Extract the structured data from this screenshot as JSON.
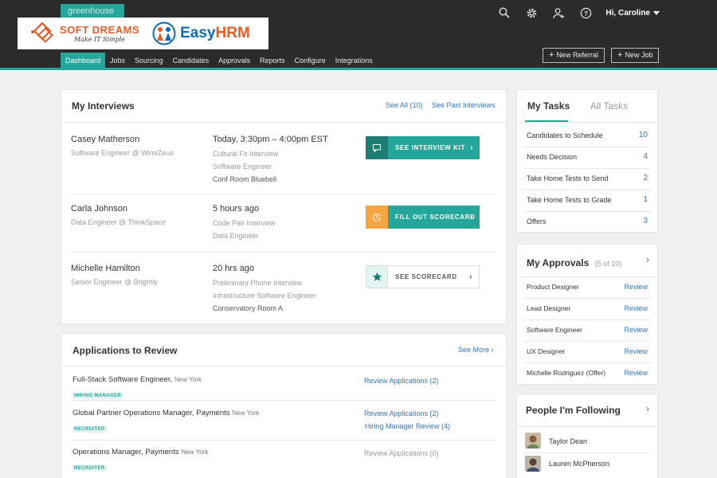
{
  "header": {
    "brand": "greenhouse",
    "user_greeting": "Hi, Caroline",
    "new_referral": "New Referral",
    "new_job": "New Job",
    "icons": [
      "search-icon",
      "gear-icon",
      "add-user-icon",
      "help-icon"
    ],
    "accent_color": "#24a69a"
  },
  "overlay_logos": {
    "softdreams_title": "SOFT DREAMS",
    "softdreams_tagline": "Make IT Simple",
    "easyhrm_easy": "Easy",
    "easyhrm_hrm": "HRM"
  },
  "nav": [
    "Dashboard",
    "Jobs",
    "Sourcing",
    "Candidates",
    "Approvals",
    "Reports",
    "Configure",
    "Integrations"
  ],
  "interviews": {
    "title": "My Interviews",
    "see_all": "See All (10)",
    "see_past": "See Past Interviews",
    "rows": [
      {
        "name": "Casey Matherson",
        "role": "Software Engineer @ WineZeus",
        "time": "Today, 3:30pm – 4:00pm EST",
        "lines": [
          "Cultural Fit Interview",
          "Software Engineer",
          "Conf Room Bluebell"
        ],
        "button": "SEE INTERVIEW KIT"
      },
      {
        "name": "Carla Johnson",
        "role": "Data Engineer @ ThinkSpace",
        "time": "5 hours ago",
        "lines": [
          "Code Pair Interview",
          "Data Engineer"
        ],
        "button": "FILL OUT SCORECARD"
      },
      {
        "name": "Michelle Hamilton",
        "role": "Senior Engineer @ Brightly",
        "time": "20 hrs ago",
        "lines": [
          "Preliminary Phone Interview",
          "Infrastructure Software Engineer",
          "Conservatory Room A"
        ],
        "button": "SEE SCORECARD"
      }
    ]
  },
  "applications": {
    "title": "Applications to Review",
    "see_more": "See More",
    "rows": [
      {
        "title": "Full-Stack Software Engineer,",
        "location": "New York",
        "tag": "HIRING MANAGER",
        "actions": [
          "Review Applications (2)"
        ]
      },
      {
        "title": "Global Partner Operations Manager, Payments",
        "location": "New York",
        "tag": "RECRUITER",
        "actions": [
          "Review Applications (2)",
          "Hiring Manager Review (4)"
        ]
      },
      {
        "title": "Operations Manager, Payments",
        "location": "New York",
        "tag": "RECRUITER",
        "actions": [
          "Review Applications (0)"
        ]
      }
    ]
  },
  "tasks": {
    "tab_my": "My Tasks",
    "tab_all": "All Tasks",
    "rows": [
      {
        "label": "Candidates to Schedule",
        "count": "10"
      },
      {
        "label": "Needs Decision",
        "count": "4"
      },
      {
        "label": "Take Home Tests to Send",
        "count": "2"
      },
      {
        "label": "Take Home Tests to Grade",
        "count": "1"
      },
      {
        "label": "Offers",
        "count": "3"
      }
    ]
  },
  "approvals": {
    "title": "My Approvals",
    "count": "(5 of 10)",
    "rows": [
      {
        "label": "Product Designer",
        "action": "Review"
      },
      {
        "label": "Lead Designer",
        "action": "Review"
      },
      {
        "label": "Software Engineer",
        "action": "Review"
      },
      {
        "label": "UX Designer",
        "action": "Review"
      },
      {
        "label": "Michelle Rodriguez (Offer)",
        "action": "Review"
      }
    ]
  },
  "following": {
    "title": "People I'm Following",
    "people": [
      "Taylor Dean",
      "Lauren McPherson"
    ]
  }
}
